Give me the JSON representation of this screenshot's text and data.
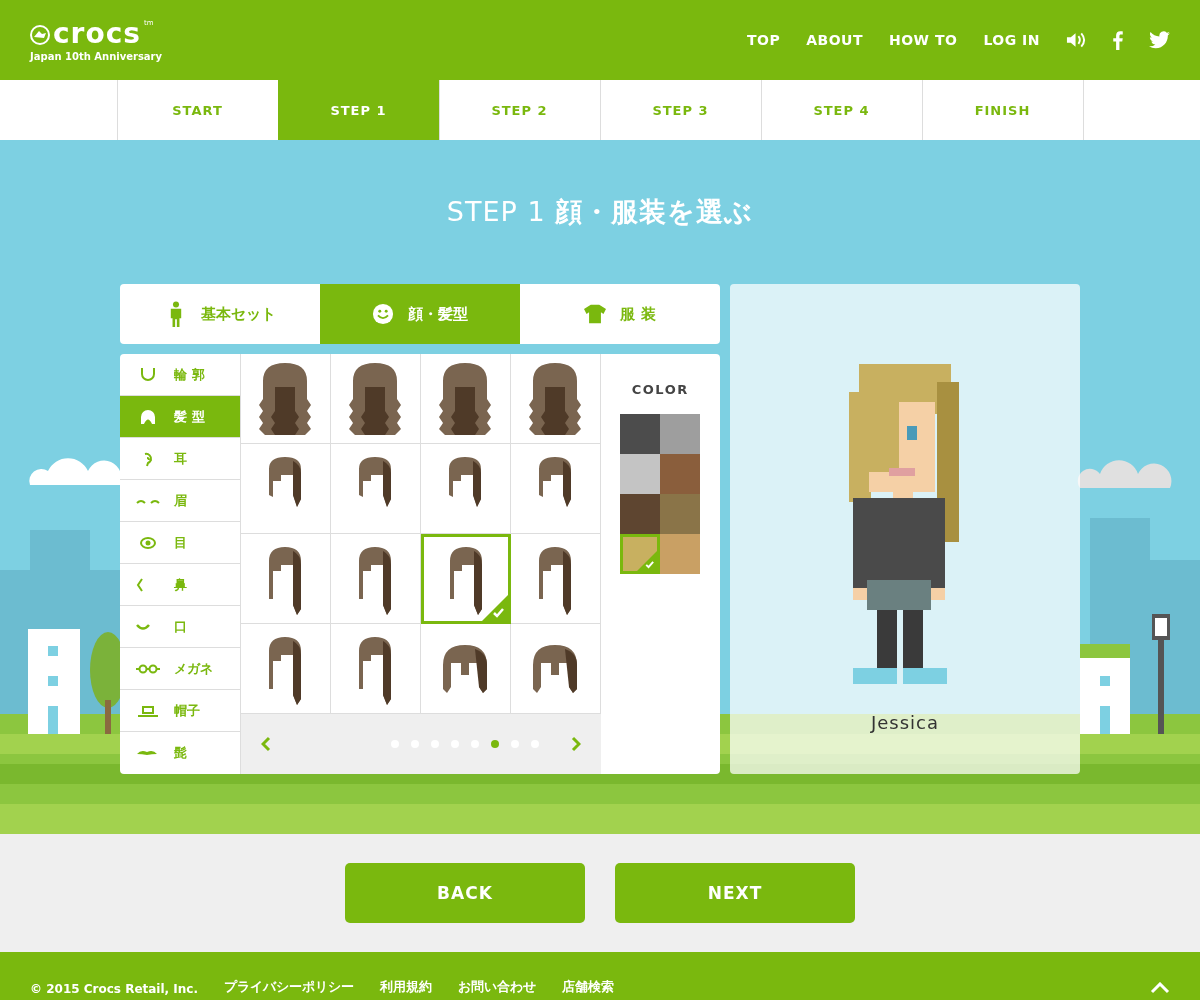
{
  "header": {
    "logo": "crocs",
    "logo_trademark": "tm",
    "tagline": "Japan 10th Anniversary",
    "nav": [
      "TOP",
      "ABOUT",
      "HOW TO",
      "LOG IN"
    ]
  },
  "steps": [
    {
      "label": "START",
      "selected": false
    },
    {
      "label": "STEP 1",
      "selected": true
    },
    {
      "label": "STEP 2",
      "selected": false
    },
    {
      "label": "STEP 3",
      "selected": false
    },
    {
      "label": "STEP 4",
      "selected": false
    },
    {
      "label": "FINISH",
      "selected": false
    }
  ],
  "page_title": "STEP 1 **顔・服装を選ぶ**",
  "category_tabs": [
    {
      "label": "基本セット",
      "kind": "person",
      "selected": false
    },
    {
      "label": "顔・髪型",
      "kind": "face",
      "selected": true
    },
    {
      "label": "服 装",
      "kind": "shirt",
      "selected": false
    }
  ],
  "parts": [
    {
      "label": "輪 郭",
      "kind": "outline",
      "selected": false
    },
    {
      "label": "髪 型",
      "kind": "hair",
      "selected": true
    },
    {
      "label": "耳",
      "kind": "ear",
      "selected": false
    },
    {
      "label": "眉",
      "kind": "brow",
      "selected": false
    },
    {
      "label": "目",
      "kind": "eye",
      "selected": false
    },
    {
      "label": "鼻",
      "kind": "nose",
      "selected": false
    },
    {
      "label": "口",
      "kind": "mouth",
      "selected": false
    },
    {
      "label": "メガネ",
      "kind": "glasses",
      "selected": false
    },
    {
      "label": "帽子",
      "kind": "hat",
      "selected": false
    },
    {
      "label": "髭",
      "kind": "beard",
      "selected": false
    }
  ],
  "hairstyles": [
    {
      "kind": "long",
      "selected": false
    },
    {
      "kind": "long",
      "selected": false
    },
    {
      "kind": "long",
      "selected": false
    },
    {
      "kind": "long",
      "selected": false
    },
    {
      "kind": "short",
      "selected": false
    },
    {
      "kind": "short",
      "selected": false
    },
    {
      "kind": "short",
      "selected": false
    },
    {
      "kind": "short",
      "selected": false
    },
    {
      "kind": "medium",
      "selected": false
    },
    {
      "kind": "medium",
      "selected": false
    },
    {
      "kind": "medium",
      "selected": true
    },
    {
      "kind": "medium",
      "selected": false
    },
    {
      "kind": "medium",
      "selected": false
    },
    {
      "kind": "medium",
      "selected": false
    },
    {
      "kind": "bob",
      "selected": false
    },
    {
      "kind": "bob",
      "selected": false
    }
  ],
  "pager": {
    "dots": [
      {
        "selected": false
      },
      {
        "selected": false
      },
      {
        "selected": false
      },
      {
        "selected": false
      },
      {
        "selected": false
      },
      {
        "selected": true
      },
      {
        "selected": false
      },
      {
        "selected": false
      }
    ]
  },
  "color_panel": {
    "title": "COLOR",
    "swatches": [
      {
        "color": "#4c4c4c",
        "selected": false
      },
      {
        "color": "#9e9e9e",
        "selected": false
      },
      {
        "color": "#c4c4c4",
        "selected": false
      },
      {
        "color": "#8a5e3c",
        "selected": false
      },
      {
        "color": "#5e4530",
        "selected": false
      },
      {
        "color": "#8a7448",
        "selected": false
      },
      {
        "color": "#c8b060",
        "selected": true
      },
      {
        "color": "#c9a064",
        "selected": false
      }
    ]
  },
  "preview": {
    "name": "Jessica"
  },
  "buttons": [
    "BACK",
    "NEXT"
  ],
  "footer": {
    "copyright": "© 2015 Crocs Retail, Inc.",
    "links": [
      "プライバシーポリシー",
      "利用規約",
      "お問い合わせ",
      "店舗検索"
    ]
  }
}
